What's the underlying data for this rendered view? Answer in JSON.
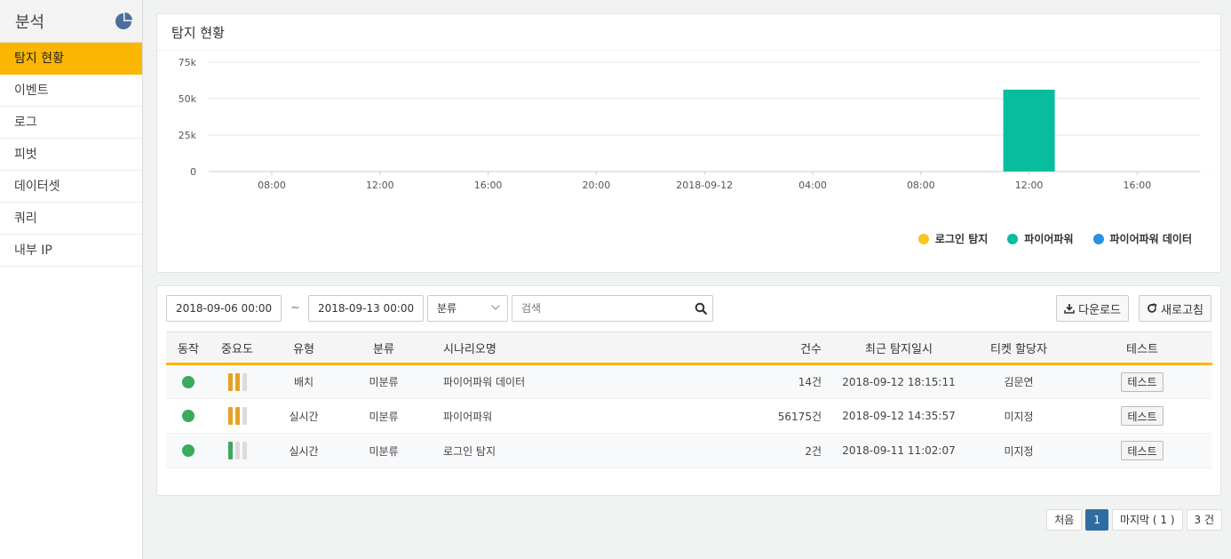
{
  "sidebar": {
    "title": "분석",
    "items": [
      {
        "label": "탐지 현황",
        "active": true
      },
      {
        "label": "이벤트"
      },
      {
        "label": "로그"
      },
      {
        "label": "피벗"
      },
      {
        "label": "데이터셋"
      },
      {
        "label": "쿼리"
      },
      {
        "label": "내부 IP"
      }
    ]
  },
  "chart_panel": {
    "title": "탐지 현황"
  },
  "chart_data": {
    "type": "bar",
    "y_ticks": [
      "0",
      "25k",
      "50k",
      "75k"
    ],
    "ylim": [
      0,
      75000
    ],
    "x_ticks": [
      "08:00",
      "12:00",
      "16:00",
      "20:00",
      "2018-09-12",
      "04:00",
      "08:00",
      "12:00",
      "16:00"
    ],
    "series": [
      {
        "name": "로그인 탐지",
        "color": "#f6c624",
        "values": [
          {
            "x": "2018-09-11 11:00",
            "y": 2
          }
        ]
      },
      {
        "name": "파이어파워",
        "color": "#08bd9e",
        "values": [
          {
            "x": "2018-09-12 12:00",
            "y": 56175
          }
        ]
      },
      {
        "name": "파이어파워 데이터",
        "color": "#2a91dc",
        "values": [
          {
            "x": "2018-09-12 18:00",
            "y": 14
          }
        ]
      }
    ],
    "legend_position": "bottom-right"
  },
  "filters": {
    "date_from": "2018-09-06 00:00",
    "date_sep": "~",
    "date_to": "2018-09-13 00:00",
    "category_selected": "분류",
    "search_placeholder": "검색",
    "download_label": "다운로드",
    "refresh_label": "새로고침"
  },
  "table": {
    "headers": {
      "action": "동작",
      "severity": "중요도",
      "type": "유형",
      "category": "분류",
      "scenario": "시나리오명",
      "count": "건수",
      "last_detected": "최근 탐지일시",
      "assignee": "티켓 할당자",
      "test": "테스트"
    },
    "rows": [
      {
        "type": "배치",
        "category": "미분류",
        "scenario": "파이어파워 데이터",
        "count": "14건",
        "last_detected": "2018-09-12 18:15:11",
        "assignee": "김문연",
        "test": "테스트",
        "severity": 2,
        "severity_color": "#e8a123"
      },
      {
        "type": "실시간",
        "category": "미분류",
        "scenario": "파이어파워",
        "count": "56175건",
        "last_detected": "2018-09-12 14:35:57",
        "assignee": "미지정",
        "test": "테스트",
        "severity": 2,
        "severity_color": "#e8a123"
      },
      {
        "type": "실시간",
        "category": "미분류",
        "scenario": "로그인 탐지",
        "count": "2건",
        "last_detected": "2018-09-11 11:02:07",
        "assignee": "미지정",
        "test": "테스트",
        "severity": 1,
        "severity_color": "#3aaa5c"
      }
    ]
  },
  "pagination": {
    "first": "처음",
    "current": "1",
    "last": "마지막 ( 1 )",
    "total": "3 건"
  },
  "colors": {
    "accent": "#fbb604",
    "status_active": "#3aaa5c",
    "page_active": "#2e6da4"
  }
}
